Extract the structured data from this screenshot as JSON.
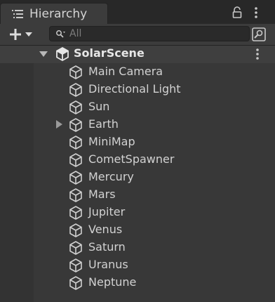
{
  "panel": {
    "title": "Hierarchy",
    "title_icon": "list-icon",
    "lock_icon": "lock-icon",
    "menu_icon": "kebab-menu-icon"
  },
  "toolbar": {
    "add_icon": "plus-dropdown-icon",
    "search_placeholder": "All",
    "search_value": "",
    "scene_view_icon": "scene-search-icon"
  },
  "scene": {
    "name": "SolarScene",
    "expanded": true,
    "icon": "unity-scene-icon"
  },
  "objects": [
    {
      "name": "Main Camera",
      "has_children": false
    },
    {
      "name": "Directional Light",
      "has_children": false
    },
    {
      "name": "Sun",
      "has_children": false
    },
    {
      "name": "Earth",
      "has_children": true
    },
    {
      "name": "MiniMap",
      "has_children": false
    },
    {
      "name": "CometSpawner",
      "has_children": false
    },
    {
      "name": "Mercury",
      "has_children": false
    },
    {
      "name": "Mars",
      "has_children": false
    },
    {
      "name": "Jupiter",
      "has_children": false
    },
    {
      "name": "Venus",
      "has_children": false
    },
    {
      "name": "Saturn",
      "has_children": false
    },
    {
      "name": "Uranus",
      "has_children": false
    },
    {
      "name": "Neptune",
      "has_children": false
    }
  ],
  "colors": {
    "panel_bg": "#383838",
    "tab_bg": "#3c3c3c",
    "scene_row_bg": "#3f3f3f",
    "text": "#d2d2d2"
  }
}
